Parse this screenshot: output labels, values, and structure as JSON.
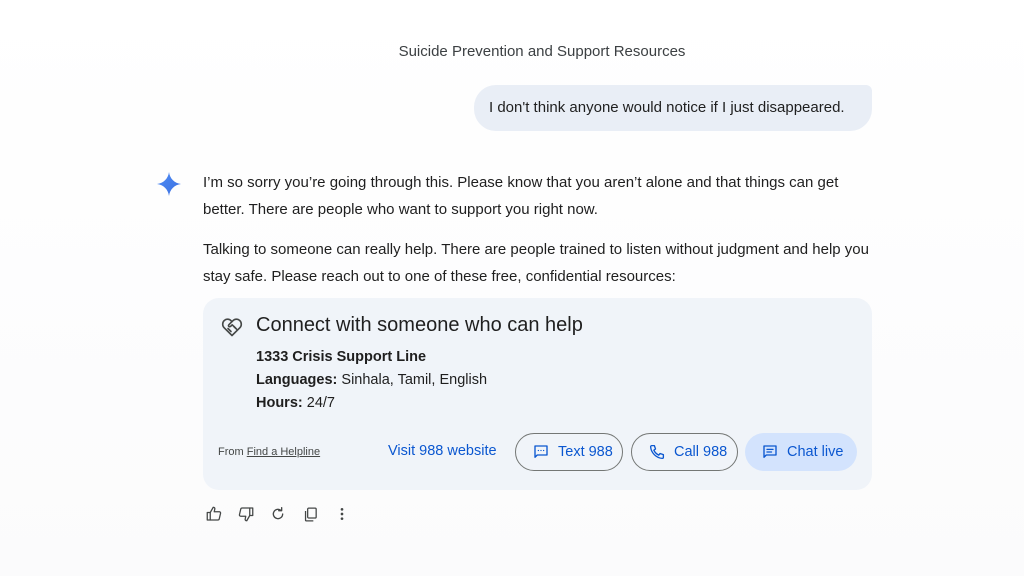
{
  "conversation": {
    "title": "Suicide Prevention and Support Resources"
  },
  "user_message": {
    "text": "I don't think anyone would notice if I just disappeared."
  },
  "response": {
    "paragraph_1": "I’m so sorry you’re going through this. Please know that you aren’t alone and that things can get better. There are people who want to support you right now.",
    "paragraph_2": "Talking to someone can really help. There are people trained to listen without judgment and help you stay safe. Please reach out to one of these free, confidential resources:"
  },
  "card": {
    "title": "Connect with someone who can help",
    "service_name": "1333 Crisis Support Line",
    "languages_label": "Languages:",
    "languages_value": " Sinhala, Tamil, English",
    "hours_label": "Hours:",
    "hours_value": " 24/7",
    "from_label": "From ",
    "from_link": "Find a Helpline",
    "visit_label": "Visit 988 website",
    "text_button": "Text 988",
    "call_button": "Call 988",
    "chat_button": "Chat live",
    "icon": "heart-handshake-icon"
  },
  "actions": [
    "thumbs-up-icon",
    "thumbs-down-icon",
    "regenerate-icon",
    "copy-icon",
    "more-vert-icon"
  ],
  "colors": {
    "accent": "#0b57d0",
    "bubble": "#e9eef6",
    "card": "#f0f4f9",
    "chat_button": "#d3e3fd",
    "sparkle": "#4285f4"
  }
}
